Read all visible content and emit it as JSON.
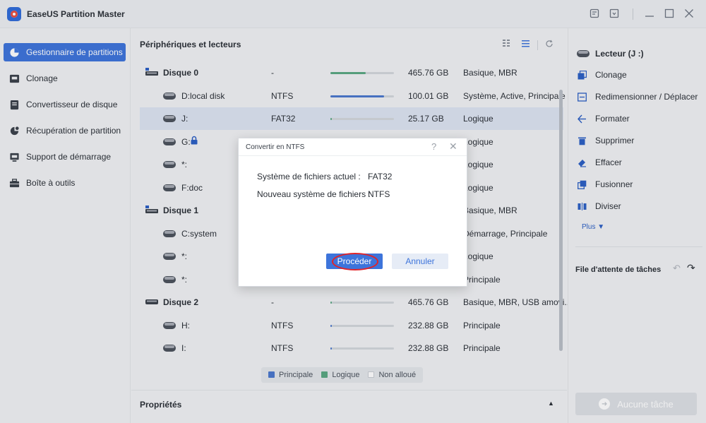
{
  "app": {
    "title": "EaseUS Partition Master"
  },
  "titlebar_icons": [
    "feedback-icon",
    "minimize-to-tray-icon",
    "minimize-icon",
    "maximize-icon",
    "close-icon"
  ],
  "sidebar": {
    "items": [
      {
        "label": "Gestionnaire de partitions",
        "icon": "pie-chart-icon",
        "active": true
      },
      {
        "label": "Clonage",
        "icon": "clone-icon"
      },
      {
        "label": "Convertisseur de disque",
        "icon": "disk-convert-icon"
      },
      {
        "label": "Récupération de partition",
        "icon": "recovery-icon"
      },
      {
        "label": "Support de démarrage",
        "icon": "boot-media-icon"
      },
      {
        "label": "Boîte à outils",
        "icon": "toolbox-icon"
      }
    ]
  },
  "main": {
    "header": "Périphériques et lecteurs",
    "rows": [
      {
        "kind": "disk",
        "name": "Disque 0",
        "fs": "-",
        "usage": 0.55,
        "bar_color": "#5aa882",
        "size": "465.76 GB",
        "type": "Basique, MBR"
      },
      {
        "kind": "part",
        "name": "D:local disk",
        "fs": "NTFS",
        "usage": 0.84,
        "bar_color": "#4a78cc",
        "size": "100.01 GB",
        "type": "Système, Active, Principale"
      },
      {
        "kind": "part",
        "name": "J:",
        "fs": "FAT32",
        "usage": 0.02,
        "bar_color": "#5aa882",
        "size": "25.17 GB",
        "type": "Logique",
        "selected": true
      },
      {
        "kind": "part",
        "name": "G:",
        "lock": true,
        "fs": "",
        "usage": 0,
        "bar_color": "#5aa882",
        "size": "",
        "type": "Logique"
      },
      {
        "kind": "part",
        "name": "*:",
        "fs": "",
        "usage": 0,
        "bar_color": "#5aa882",
        "size": "",
        "type": "Logique"
      },
      {
        "kind": "part",
        "name": "F:doc",
        "fs": "",
        "usage": 0,
        "bar_color": "#5aa882",
        "size": "",
        "type": "Logique"
      },
      {
        "kind": "disk",
        "name": "Disque 1",
        "fs": "",
        "usage": 0,
        "bar_color": "#5aa882",
        "size": "",
        "type": "Basique, MBR"
      },
      {
        "kind": "part",
        "name": "C:system",
        "fs": "",
        "usage": 0,
        "bar_color": "#4a78cc",
        "size": "",
        "type": "Démarrage, Principale"
      },
      {
        "kind": "part",
        "name": "*:",
        "fs": "",
        "usage": 0,
        "bar_color": "#5aa882",
        "size": "",
        "type": "Logique"
      },
      {
        "kind": "part",
        "name": "*:",
        "fs": "",
        "usage": 0,
        "bar_color": "#4a78cc",
        "size": "",
        "type": "Principale"
      },
      {
        "kind": "usbdisk",
        "name": "Disque 2",
        "fs": "-",
        "usage": 0.02,
        "bar_color": "#5aa882",
        "size": "465.76 GB",
        "type": "Basique, MBR, USB amovi..."
      },
      {
        "kind": "part",
        "name": "H:",
        "fs": "NTFS",
        "usage": 0.02,
        "bar_color": "#4a78cc",
        "size": "232.88 GB",
        "type": "Principale"
      },
      {
        "kind": "part",
        "name": "I:",
        "fs": "NTFS",
        "usage": 0.02,
        "bar_color": "#4a78cc",
        "size": "232.88 GB",
        "type": "Principale"
      }
    ],
    "legend": [
      {
        "label": "Principale",
        "color": "#4a78cc"
      },
      {
        "label": "Logique",
        "color": "#5aa882"
      },
      {
        "label": "Non alloué",
        "color": "#ffffff"
      }
    ],
    "properties": "Propriétés"
  },
  "right": {
    "title": "Lecteur (J :)",
    "actions": [
      {
        "label": "Clonage",
        "icon": "clone-icon"
      },
      {
        "label": "Redimensionner / Déplacer",
        "icon": "resize-icon"
      },
      {
        "label": "Formater",
        "icon": "format-icon"
      },
      {
        "label": "Supprimer",
        "icon": "delete-icon"
      },
      {
        "label": "Effacer",
        "icon": "wipe-icon"
      },
      {
        "label": "Fusionner",
        "icon": "merge-icon"
      },
      {
        "label": "Diviser",
        "icon": "split-icon"
      }
    ],
    "more": "Plus",
    "queue": "File d'attente de tâches",
    "no_task": "Aucune tâche"
  },
  "dialog": {
    "title": "Convertir en NTFS",
    "current_label": "Système de fichiers actuel :",
    "current_value": "FAT32",
    "new_label": "Nouveau système de fichiers :",
    "new_value": "NTFS",
    "proceed": "Procéder",
    "cancel": "Annuler"
  }
}
